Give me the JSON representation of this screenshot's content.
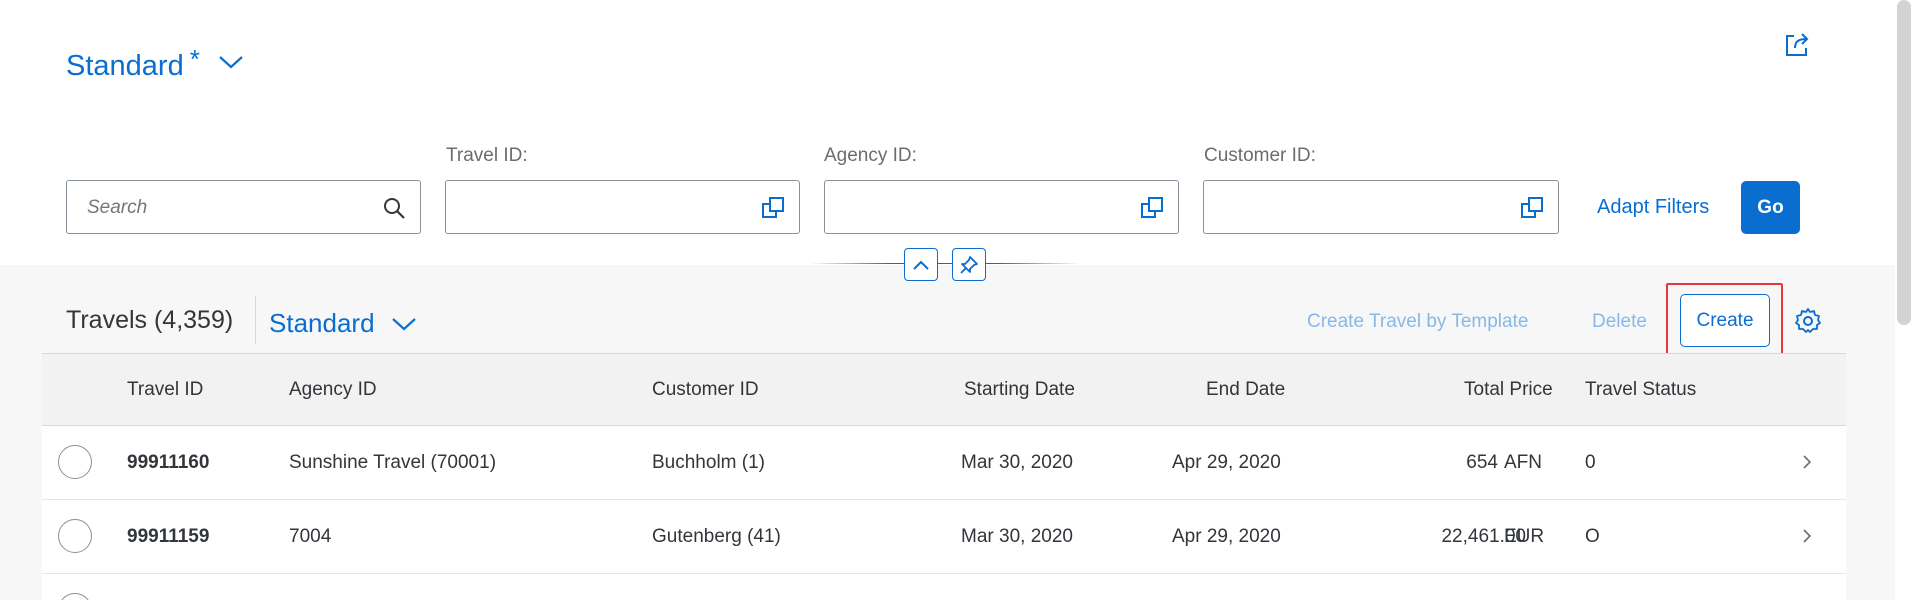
{
  "header": {
    "variant_title": "Standard",
    "variant_modified_marker": "*"
  },
  "filters": {
    "search_placeholder": "Search",
    "travel_id_label": "Travel ID:",
    "agency_id_label": "Agency ID:",
    "customer_id_label": "Customer ID:",
    "adapt_filters_label": "Adapt Filters",
    "go_label": "Go"
  },
  "table": {
    "title": "Travels (4,359)",
    "variant": "Standard",
    "toolbar": {
      "create_by_template_label": "Create Travel by Template",
      "delete_label": "Delete",
      "create_label": "Create"
    },
    "columns": [
      "Travel ID",
      "Agency ID",
      "Customer ID",
      "Starting Date",
      "End Date",
      "Total Price",
      "Travel Status"
    ],
    "rows": [
      {
        "travel_id": "99911160",
        "agency_id": "Sunshine Travel (70001)",
        "customer_id": "Buchholm (1)",
        "starting_date": "Mar 30, 2020",
        "end_date": "Apr 29, 2020",
        "total_price": "654",
        "currency": "AFN",
        "travel_status": "0"
      },
      {
        "travel_id": "99911159",
        "agency_id": "7004",
        "customer_id": "Gutenberg (41)",
        "starting_date": "Mar 30, 2020",
        "end_date": "Apr 29, 2020",
        "total_price": "22,461.00",
        "currency": "EUR",
        "travel_status": "O"
      }
    ]
  },
  "colors": {
    "accent": "#0a6ed1",
    "highlight": "#e63a3a",
    "disabled_text": "#86b9ea"
  },
  "icons": [
    "chevron-down-icon",
    "share-icon",
    "search-icon",
    "value-help-icon",
    "chevron-up-icon",
    "pin-icon",
    "settings-icon",
    "navigation-arrow-icon"
  ]
}
